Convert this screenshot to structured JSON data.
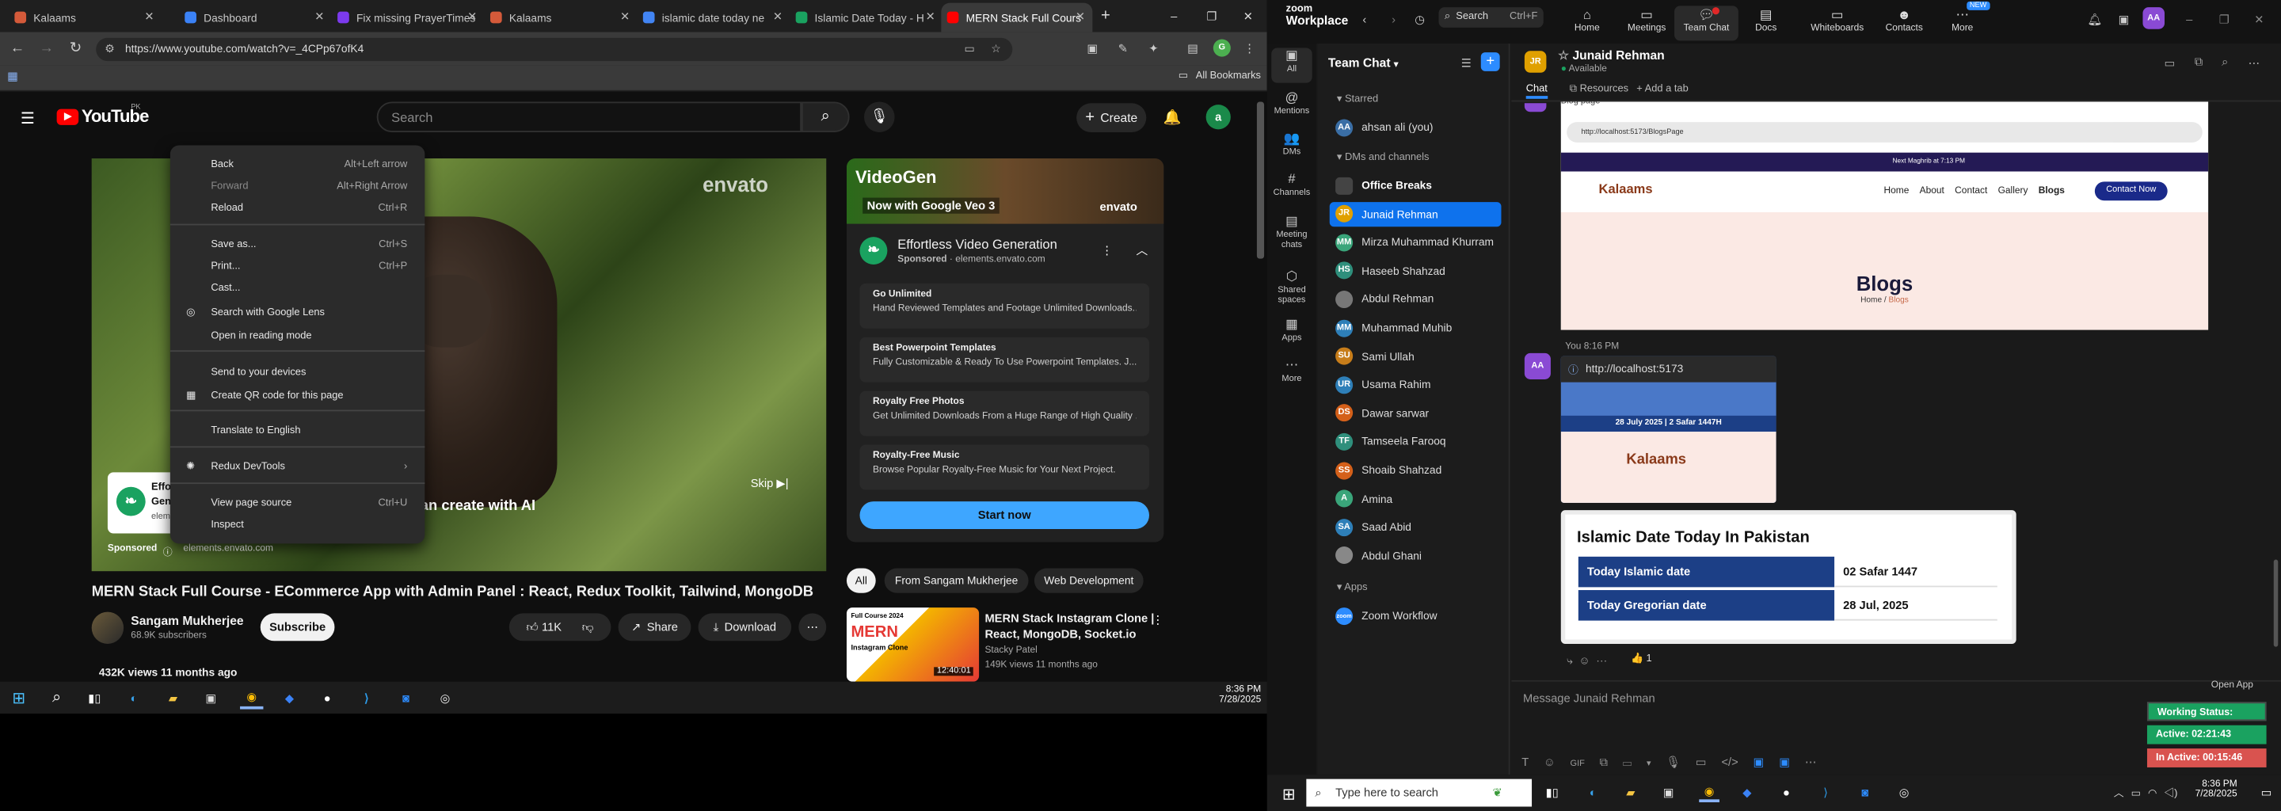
{
  "browser": {
    "tabs": [
      {
        "label": "Kalaams",
        "color": "#d45a3a"
      },
      {
        "label": "Dashboard",
        "color": "#3b82f6"
      },
      {
        "label": "Fix missing PrayerTimes",
        "color": "#7c3aed"
      },
      {
        "label": "Kalaams",
        "color": "#d45a3a"
      },
      {
        "label": "islamic date today ne",
        "color": "#4285f4"
      },
      {
        "label": "Islamic Date Today - H",
        "color": "#1aa260"
      },
      {
        "label": "MERN Stack Full Cours",
        "color": "#ff0000"
      }
    ],
    "url": "https://www.youtube.com/watch?v=_4CPp67ofK4",
    "bookmarks_label": "All Bookmarks"
  },
  "youtube": {
    "logo_text": "YouTube",
    "region": "PK",
    "search_placeholder": "Search",
    "create_label": "Create",
    "avatar_letter": "a",
    "video_title": "MERN Stack Full Course - ECommerce App with Admin Panel : React, Redux Toolkit, Tailwind, MongoDB",
    "channel_name": "Sangam Mukherjee",
    "subscribers": "68.9K subscribers",
    "subscribe_label": "Subscribe",
    "likes": "11K",
    "share_label": "Share",
    "download_label": "Download",
    "views_line": "432K views  11 months ago",
    "player_overlay": {
      "envato": "envato",
      "caption": "an create with AI",
      "skip": "Skip",
      "sponsored": "Sponsored",
      "ad_domain": "elements.envato.com",
      "card_title_fragment": "Effo",
      "card_sub_fragment": "Gen",
      "card_sub2": "eleme"
    },
    "ad": {
      "banner_title": "VideoGen",
      "banner_sub": "Now with Google Veo 3",
      "banner_brand": "envato",
      "title": "Effortless Video Generation",
      "sponsored": "Sponsored",
      "domain": "elements.envato.com",
      "cards": [
        {
          "title": "Go Unlimited",
          "desc": "Hand Reviewed Templates and Footage Unlimited Downloads..."
        },
        {
          "title": "Best Powerpoint Templates",
          "desc": "Fully Customizable & Ready To Use Powerpoint Templates. J..."
        },
        {
          "title": "Royalty Free Photos",
          "desc": "Get Unlimited Downloads From a Huge Range of High Quality ..."
        },
        {
          "title": "Royalty-Free Music",
          "desc": "Browse Popular Royalty-Free Music for Your Next Project."
        }
      ],
      "cta": "Start now"
    },
    "chips": [
      "All",
      "From Sangam Mukherjee",
      "Web Development"
    ],
    "related": {
      "title_line1": "MERN Stack Instagram Clone |",
      "title_line2": "React, MongoDB, Socket.io",
      "channel": "Stacky Patel",
      "meta": "149K views  11 months ago",
      "duration": "12:40:01",
      "thumb_top": "Full Course 2024",
      "thumb_main": "MERN",
      "thumb_sub": "Instagram Clone"
    }
  },
  "context_menu": {
    "items": [
      {
        "label": "Back",
        "shortcut": "Alt+Left arrow",
        "disabled": false
      },
      {
        "label": "Forward",
        "shortcut": "Alt+Right Arrow",
        "disabled": true
      },
      {
        "label": "Reload",
        "shortcut": "Ctrl+R",
        "disabled": false
      },
      {
        "label": "Save as...",
        "shortcut": "Ctrl+S",
        "disabled": false
      },
      {
        "label": "Print...",
        "shortcut": "Ctrl+P",
        "disabled": false
      },
      {
        "label": "Cast...",
        "shortcut": "",
        "disabled": false
      },
      {
        "label": "Search with Google Lens",
        "shortcut": "",
        "disabled": false
      },
      {
        "label": "Open in reading mode",
        "shortcut": "",
        "disabled": false
      },
      {
        "label": "Send to your devices",
        "shortcut": "",
        "disabled": false
      },
      {
        "label": "Create QR code for this page",
        "shortcut": "",
        "disabled": false
      },
      {
        "label": "Translate to English",
        "shortcut": "",
        "disabled": false
      },
      {
        "label": "Redux DevTools",
        "shortcut": "",
        "disabled": false
      },
      {
        "label": "View page source",
        "shortcut": "Ctrl+U",
        "disabled": false
      },
      {
        "label": "Inspect",
        "shortcut": "",
        "disabled": false
      }
    ]
  },
  "taskbar_left": {
    "time": "8:36 PM",
    "date": "7/28/2025"
  },
  "zoom": {
    "brand_top": "zoom",
    "brand_bottom": "Workplace",
    "search_label": "Search",
    "search_shortcut": "Ctrl+F",
    "nav": [
      "Home",
      "Meetings",
      "Team Chat",
      "Docs",
      "Whiteboards",
      "Contacts",
      "More"
    ],
    "new_badge": "NEW",
    "user_initials": "AA",
    "rail": [
      {
        "label": "All",
        "icon": "▣"
      },
      {
        "label": "Mentions",
        "icon": "@"
      },
      {
        "label": "DMs",
        "icon": "👥"
      },
      {
        "label": "Channels",
        "icon": "#"
      },
      {
        "label": "Meeting chats",
        "icon": "▤"
      },
      {
        "label": "Shared spaces",
        "icon": "⬡"
      },
      {
        "label": "Apps",
        "icon": "▦"
      },
      {
        "label": "More",
        "icon": "⋯"
      }
    ],
    "panel_title": "Team Chat",
    "starred_label": "Starred",
    "starred": [
      {
        "name": "ahsan ali (you)",
        "initials": "AA",
        "color": "#3a6ea5"
      }
    ],
    "dms_label": "DMs and channels",
    "dms": [
      {
        "name": "Office Breaks",
        "initials": "",
        "color": "#444",
        "bold": true
      },
      {
        "name": "Junaid Rehman",
        "initials": "JR",
        "color": "#e0a000",
        "selected": true
      },
      {
        "name": "Mirza Muhammad Khurram",
        "initials": "MM",
        "color": "#3aa57a"
      },
      {
        "name": "Haseeb Shahzad",
        "initials": "HS",
        "color": "#2f8f7c"
      },
      {
        "name": "Abdul Rehman",
        "initials": "",
        "color": "#777"
      },
      {
        "name": "Muhammad Muhib",
        "initials": "MM",
        "color": "#2e7fb8"
      },
      {
        "name": "Sami Ullah",
        "initials": "SU",
        "color": "#c77d1a"
      },
      {
        "name": "Usama Rahim",
        "initials": "UR",
        "color": "#2e7fb8"
      },
      {
        "name": "Dawar sarwar",
        "initials": "DS",
        "color": "#d4601a"
      },
      {
        "name": "Tamseela Farooq",
        "initials": "TF",
        "color": "#2f8f7c"
      },
      {
        "name": "Shoaib Shahzad",
        "initials": "SS",
        "color": "#d4601a"
      },
      {
        "name": "Amina",
        "initials": "A",
        "color": "#3aa57a"
      },
      {
        "name": "Saad Abid",
        "initials": "SA",
        "color": "#2e7fb8"
      },
      {
        "name": "Abdul Ghani",
        "initials": "",
        "color": "#888"
      }
    ],
    "apps_label": "Apps",
    "apps": [
      {
        "name": "Zoom Workflow",
        "initials": "zoom",
        "color": "#2d8cff"
      }
    ],
    "chat": {
      "contact_name": "Junaid Rehman",
      "contact_initials": "JR",
      "contact_status": "Available",
      "tabs": [
        "Chat",
        "Resources",
        "Add a tab"
      ],
      "blog_header_fragment": "Blog page",
      "preview1": {
        "url": "http://localhost:5173/BlogsPage",
        "brand": "Kalaams",
        "nav": [
          "Home",
          "About",
          "Contact",
          "Gallery",
          "Blogs"
        ],
        "cta": "Contact Now",
        "heading": "Blogs",
        "crumb_home": "Home",
        "crumb_sep": "/",
        "crumb_page": "Blogs",
        "toolbar_date": "Next Maghrib at 7:13 PM"
      },
      "sender_initials": "AA",
      "msg_meta": "You 8:16 PM",
      "link": "http://localhost:5173",
      "preview2": {
        "date_bar": "28 July 2025 | 2 Safar 1447H",
        "brand": "Kalaams"
      },
      "card": {
        "title": "Islamic Date Today In Pakistan",
        "rows": [
          {
            "label": "Today Islamic date",
            "value": "02 Safar 1447"
          },
          {
            "label": "Today Gregorian date",
            "value": "28 Jul, 2025"
          }
        ]
      },
      "reaction_count": "1",
      "composer_placeholder": "Message Junaid Rehman",
      "open_app": "Open App"
    },
    "status": [
      {
        "label": "Working Status: Active",
        "color": "#1aa260"
      },
      {
        "label": "Active: 02:21:43",
        "color": "#1aa260"
      },
      {
        "label": "In Active: 00:15:46",
        "color": "#d9534f"
      }
    ]
  },
  "taskbar_right": {
    "search_placeholder": "Type here to search",
    "time": "8:36 PM",
    "date": "7/28/2025"
  }
}
